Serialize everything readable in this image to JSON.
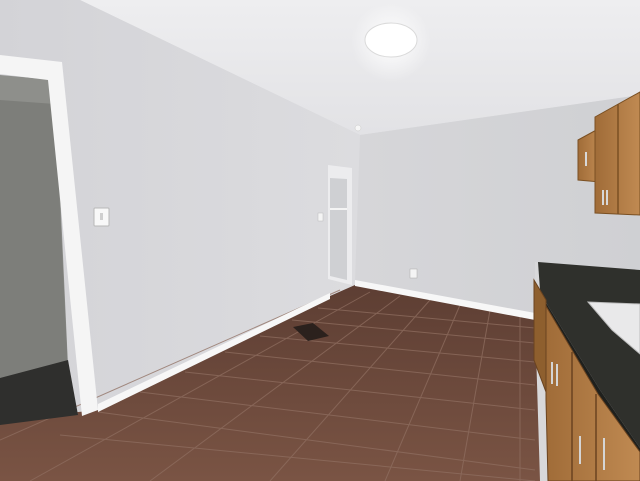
{
  "scene": {
    "kind": "empty kitchen/dining room with tile floor",
    "colors": {
      "wall": "#d9d9dc",
      "ceiling": "#f3f3f4",
      "baseboard": "#f7f7f7",
      "tile": "#6f4a3c",
      "grout": "#9a7d70",
      "cabinet": "#b07d45",
      "countertop": "#2f302c",
      "doorway_dark": "#3a3a38"
    },
    "objects": [
      "ceiling-light",
      "left-doorway",
      "light-switch",
      "hallway-opening",
      "electrical-outlet",
      "floor-vent",
      "upper-cabinets",
      "lower-cabinets",
      "granite-countertop",
      "kitchen-sink"
    ]
  }
}
